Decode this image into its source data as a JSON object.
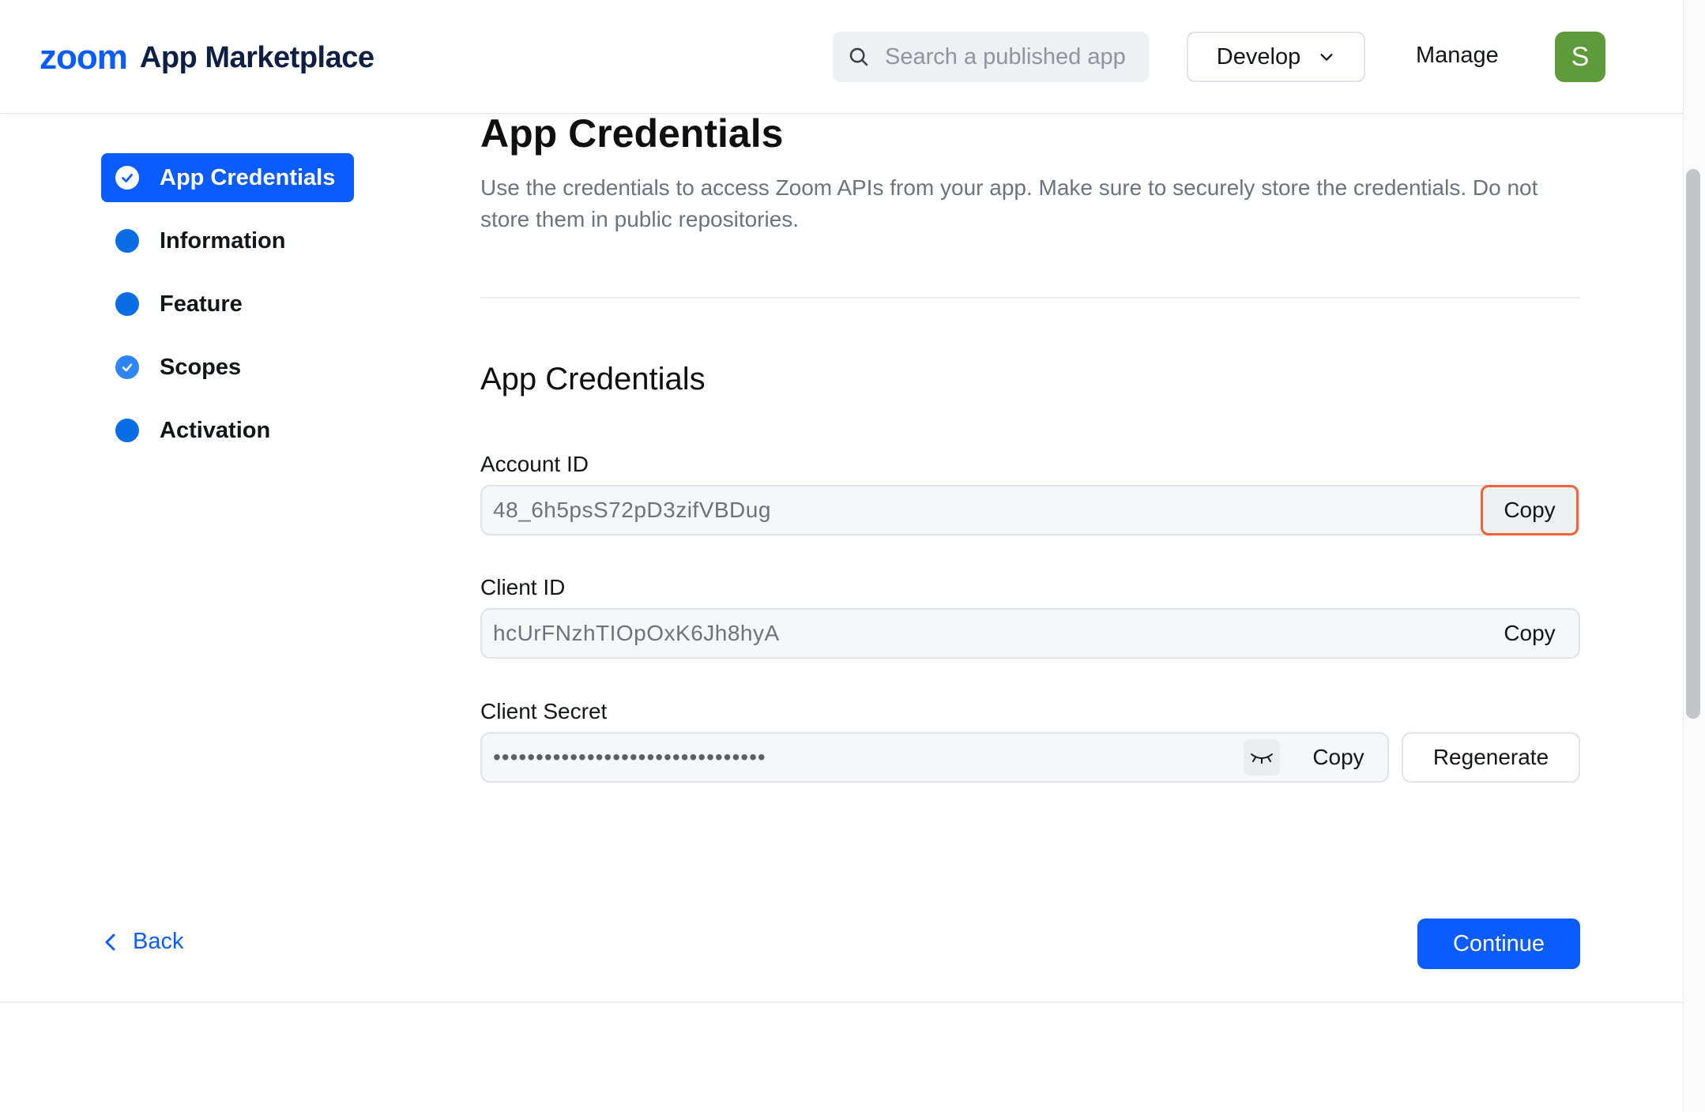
{
  "header": {
    "logo_brand": "zoom",
    "logo_product": "App Marketplace",
    "search_placeholder": "Search a published app",
    "develop_label": "Develop",
    "manage_label": "Manage",
    "avatar_initial": "S",
    "avatar_color": "#5e9b3a"
  },
  "sidebar": {
    "items": [
      {
        "label": "App Credentials",
        "state": "active-completed"
      },
      {
        "label": "Information",
        "state": "incomplete"
      },
      {
        "label": "Feature",
        "state": "incomplete"
      },
      {
        "label": "Scopes",
        "state": "completed"
      },
      {
        "label": "Activation",
        "state": "incomplete"
      }
    ]
  },
  "main": {
    "title": "App Credentials",
    "description": "Use the credentials to access Zoom APIs from your app. Make sure to securely store the credentials. Do not store them in public repositories.",
    "section_title": "App Credentials",
    "account_id": {
      "label": "Account ID",
      "value": "48_6h5psS72pD3zifVBDug",
      "copy_label": "Copy"
    },
    "client_id": {
      "label": "Client ID",
      "value": "hcUrFNzhTIOpOxK6Jh8hyA",
      "copy_label": "Copy"
    },
    "client_secret": {
      "label": "Client Secret",
      "value": "••••••••••••••••••••••••••••••••",
      "copy_label": "Copy",
      "regenerate_label": "Regenerate"
    }
  },
  "footer": {
    "back_label": "Back",
    "continue_label": "Continue"
  },
  "colors": {
    "accent": "#0b5cff",
    "focus_ring": "#f06437"
  }
}
